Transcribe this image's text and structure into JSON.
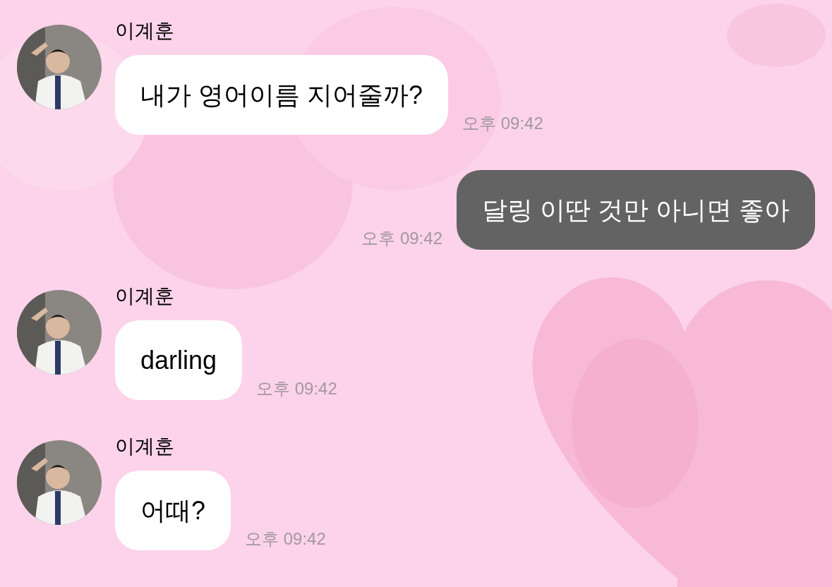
{
  "messages": [
    {
      "kind": "incoming",
      "sender": "이계훈",
      "text": "내가 영어이름 지어줄까?",
      "time": "오후 09:42"
    },
    {
      "kind": "outgoing",
      "text": "달링 이딴 것만 아니면 좋아",
      "time": "오후 09:42"
    },
    {
      "kind": "incoming",
      "sender": "이계훈",
      "text": "darling",
      "time": "오후 09:42"
    },
    {
      "kind": "incoming",
      "sender": "이계훈",
      "text": "어때?",
      "time": "오후 09:42"
    }
  ]
}
